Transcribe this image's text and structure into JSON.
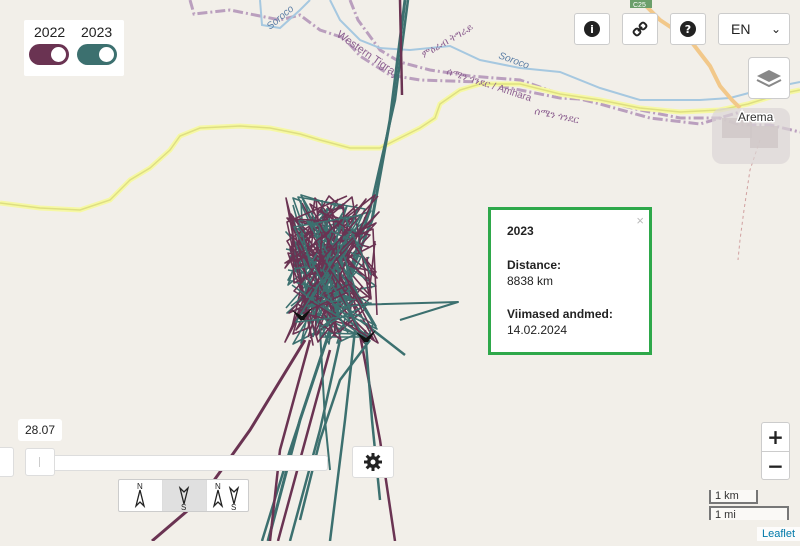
{
  "year_toggles": [
    {
      "label": "2022",
      "color": "#6a3352",
      "enabled": true
    },
    {
      "label": "2023",
      "color": "#3c706f",
      "enabled": true
    }
  ],
  "toolbar": {
    "info_icon": "info-icon",
    "link_icon": "link-icon",
    "help_icon": "help-icon",
    "language": "EN"
  },
  "map_labels": {
    "road1": "Soroco",
    "region1": "Western Tigray",
    "region1_local": "ምዕራብ ትግራይ",
    "region2": "ሰሜን ጎንደር / Amhara",
    "region2_local": "ሰሜን ጎንደር",
    "road2": "Soroco",
    "town": "Arema",
    "shield": "C25"
  },
  "popup": {
    "year": "2023",
    "distance_label": "Distance:",
    "distance_value": "8838 km",
    "last_data_label": "Viimased andmed:",
    "last_data_value": "14.02.2024",
    "close_symbol": "×"
  },
  "slider": {
    "value": "28.07"
  },
  "direction_buttons": [
    {
      "name": "north",
      "label_top": "N",
      "label_bottom": "",
      "active": false
    },
    {
      "name": "south",
      "label_top": "",
      "label_bottom": "S",
      "active": true
    },
    {
      "name": "north-south",
      "label_top": "N",
      "label_bottom": "S",
      "active": false
    }
  ],
  "zoom": {
    "in": "+",
    "out": "−"
  },
  "scale": {
    "km": "1 km",
    "mi": "1 mi"
  },
  "attribution": "Leaflet"
}
